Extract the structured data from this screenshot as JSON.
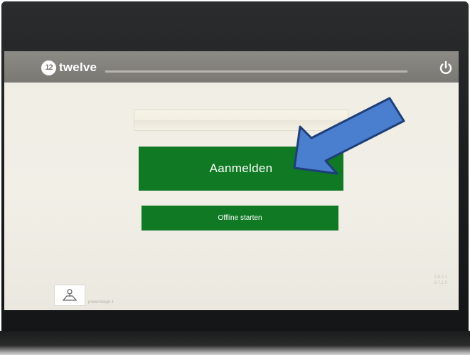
{
  "app": {
    "logo_mark": "12",
    "logo_text": "twelve"
  },
  "toolbar": {
    "power_icon": "power-icon"
  },
  "login": {
    "input_value": "",
    "login_label": "Aanmelden",
    "offline_label": "Offline starten"
  },
  "footer": {
    "version_line1": "3.8.0.1",
    "version_line2": "8.7.1.0",
    "label": "powerstage 1",
    "tile_icon": "user-location-icon"
  },
  "annotation": {
    "arrow_icon": "pointer-arrow-icon",
    "arrow_color": "#4a7fd0"
  },
  "colors": {
    "accent_green": "#0f7a23",
    "topbar_gray": "#7a7873",
    "screen_bg": "#efede4"
  }
}
